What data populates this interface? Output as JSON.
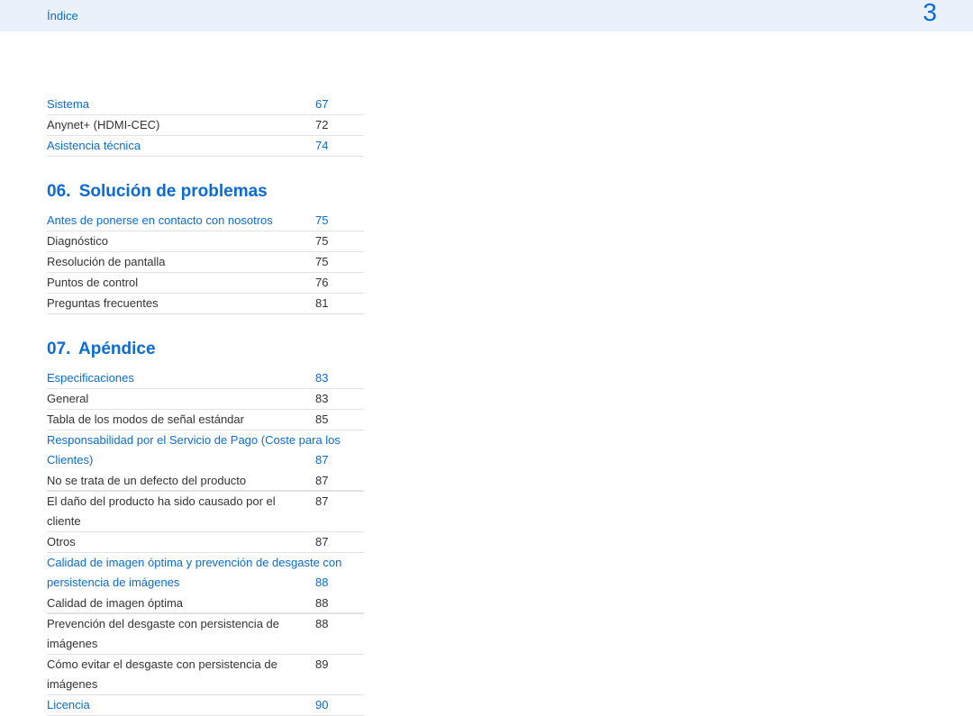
{
  "header": {
    "title": "Índice"
  },
  "page_number": "3",
  "pre_items": [
    {
      "label": "Sistema",
      "page": "67",
      "link": true
    },
    {
      "label": "Anynet+ (HDMI-CEC)",
      "page": "72",
      "link": false
    },
    {
      "label": "Asistencia técnica",
      "page": "74",
      "link": true
    }
  ],
  "section06": {
    "num": "06.",
    "title": "Solución de problemas",
    "items": [
      {
        "label": "Antes de ponerse en contacto con nosotros",
        "page": "75",
        "link": true
      },
      {
        "label": "Diagnóstico",
        "page": "75",
        "link": false
      },
      {
        "label": "Resolución de pantalla",
        "page": "75",
        "link": false
      },
      {
        "label": "Puntos de control",
        "page": "76",
        "link": false
      },
      {
        "label": "Preguntas frecuentes",
        "page": "81",
        "link": false
      }
    ]
  },
  "section07": {
    "num": "07.",
    "title": "Apéndice",
    "items": [
      {
        "label": "Especificaciones",
        "page": "83",
        "link": true
      },
      {
        "label": "General",
        "page": "83",
        "link": false
      },
      {
        "label": "Tabla de los modos de señal estándar",
        "page": "85",
        "link": false
      },
      {
        "label": "Responsabilidad por el Servicio de Pago (Coste para los Clientes)",
        "page": "87",
        "link": true
      },
      {
        "label": "No se trata de un defecto del producto",
        "page": "87",
        "link": false
      },
      {
        "label": "El daño del producto ha sido causado por el cliente",
        "page": "87",
        "link": false
      },
      {
        "label": "Otros",
        "page": "87",
        "link": false
      },
      {
        "label": "Calidad de imagen óptima y prevención de desgaste con persistencia de imágenes",
        "page": "88",
        "link": true
      },
      {
        "label": "Calidad de imagen óptima",
        "page": "88",
        "link": false
      },
      {
        "label": "Prevención del desgaste con persistencia de imágenes",
        "page": "88",
        "link": false
      },
      {
        "label": "Cómo evitar el desgaste con persistencia de imágenes",
        "page": "89",
        "link": false
      },
      {
        "label": "Licencia",
        "page": "90",
        "link": true
      }
    ]
  }
}
